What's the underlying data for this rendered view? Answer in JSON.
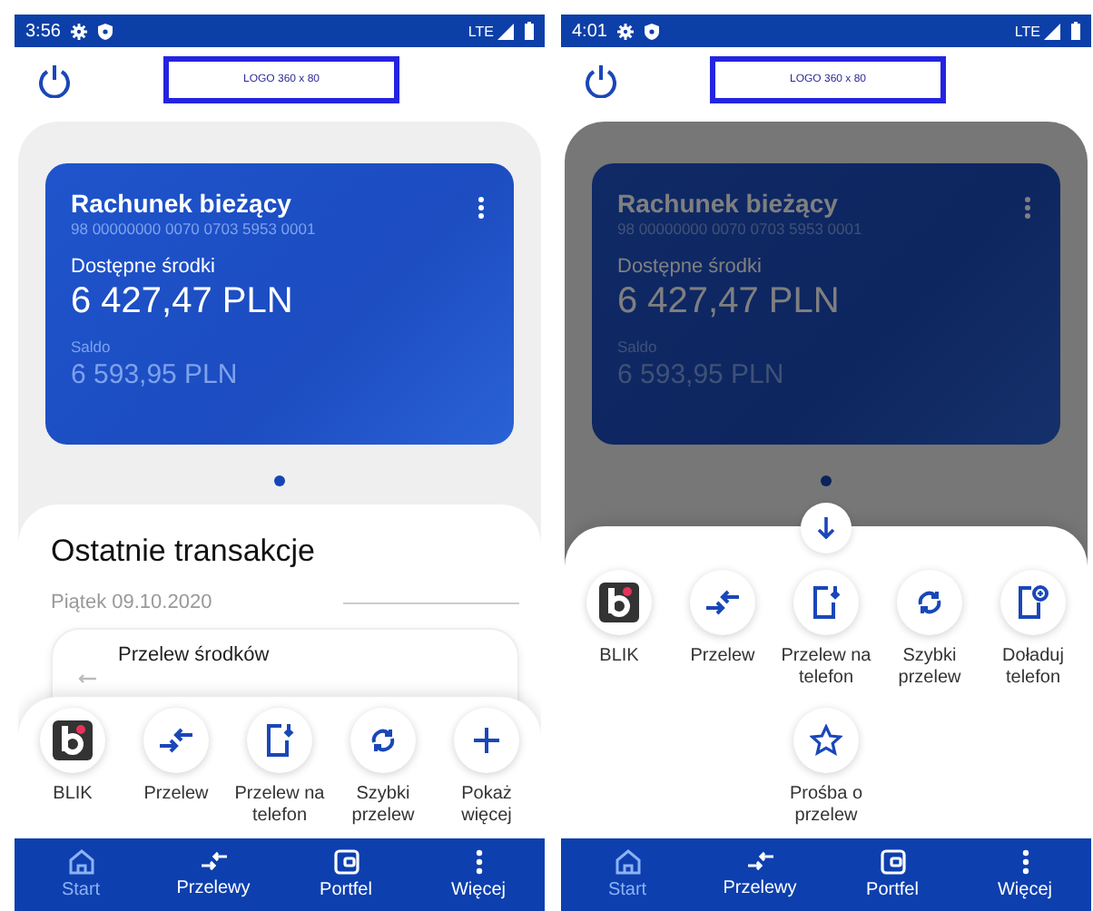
{
  "screens": [
    {
      "status_bar": {
        "time": "3:56",
        "network": "LTE"
      },
      "logo": "LOGO 360 x 80",
      "account": {
        "name": "Rachunek bieżący",
        "number": "98 00000000 0070 0703 5953 0001",
        "available_label": "Dostępne środki",
        "available": "6 427,47 PLN",
        "balance_label": "Saldo",
        "balance": "6 593,95 PLN"
      },
      "transactions": {
        "title": "Ostatnie transakcje",
        "date": "Piątek 09.10.2020",
        "items": [
          {
            "title": "Przelew środków"
          }
        ]
      },
      "sheet": {
        "expanded": false,
        "actions": [
          {
            "kind": "blik",
            "label": "BLIK"
          },
          {
            "kind": "transfer",
            "label": "Przelew"
          },
          {
            "kind": "phone-transfer",
            "label": "Przelew na telefon"
          },
          {
            "kind": "quick",
            "label": "Szybki przelew"
          },
          {
            "kind": "more",
            "label": "Pokaż więcej"
          }
        ]
      },
      "nav": [
        {
          "kind": "home",
          "label": "Start",
          "selected": true
        },
        {
          "kind": "transfers",
          "label": "Przelewy",
          "selected": false
        },
        {
          "kind": "wallet",
          "label": "Portfel",
          "selected": false
        },
        {
          "kind": "more",
          "label": "Więcej",
          "selected": false
        }
      ]
    },
    {
      "status_bar": {
        "time": "4:01",
        "network": "LTE"
      },
      "logo": "LOGO 360 x 80",
      "account": {
        "name": "Rachunek bieżący",
        "number": "98 00000000 0070 0703 5953 0001",
        "available_label": "Dostępne środki",
        "available": "6 427,47 PLN",
        "balance_label": "Saldo",
        "balance": "6 593,95 PLN"
      },
      "sheet": {
        "expanded": true,
        "actions": [
          {
            "kind": "blik",
            "label": "BLIK"
          },
          {
            "kind": "transfer",
            "label": "Przelew"
          },
          {
            "kind": "phone-transfer",
            "label": "Przelew na telefon"
          },
          {
            "kind": "quick",
            "label": "Szybki przelew"
          },
          {
            "kind": "topup",
            "label": "Doładuj telefon"
          },
          {
            "kind": "request",
            "label": "Prośba o przelew"
          }
        ]
      },
      "nav": [
        {
          "kind": "home",
          "label": "Start",
          "selected": true
        },
        {
          "kind": "transfers",
          "label": "Przelewy",
          "selected": false
        },
        {
          "kind": "wallet",
          "label": "Portfel",
          "selected": false
        },
        {
          "kind": "more",
          "label": "Więcej",
          "selected": false
        }
      ]
    }
  ]
}
